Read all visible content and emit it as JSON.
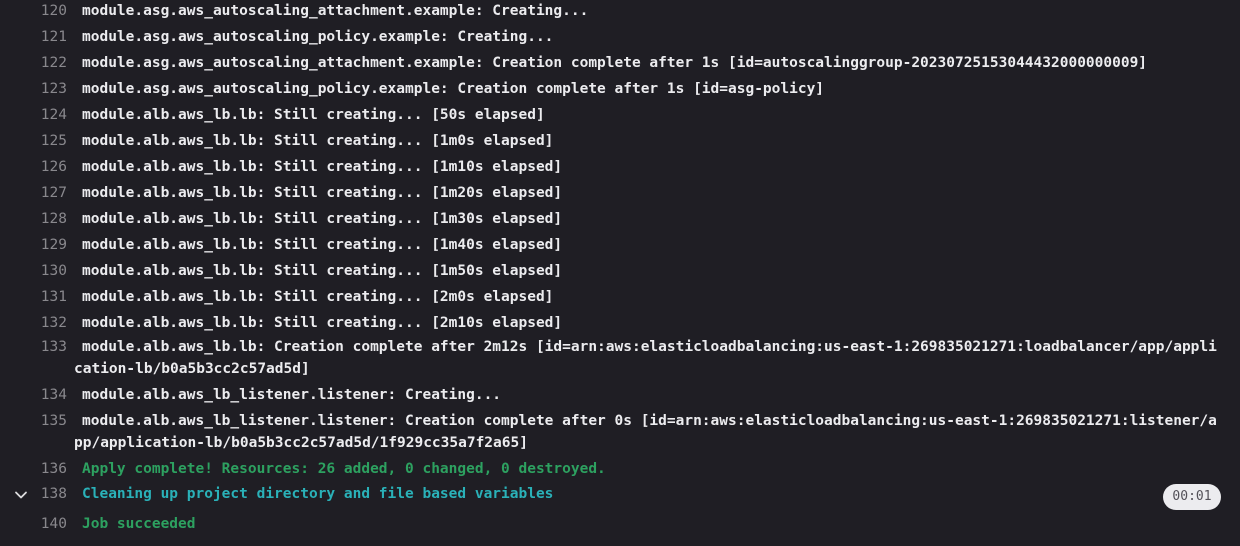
{
  "log": {
    "lines": [
      {
        "num": "120",
        "text": "module.asg.aws_autoscaling_attachment.example: Creating..."
      },
      {
        "num": "121",
        "text": "module.asg.aws_autoscaling_policy.example: Creating..."
      },
      {
        "num": "122",
        "text": "module.asg.aws_autoscaling_attachment.example: Creation complete after 1s [id=autoscalinggroup-20230725153044432000000009]"
      },
      {
        "num": "123",
        "text": "module.asg.aws_autoscaling_policy.example: Creation complete after 1s [id=asg-policy]"
      },
      {
        "num": "124",
        "text": "module.alb.aws_lb.lb: Still creating... [50s elapsed]"
      },
      {
        "num": "125",
        "text": "module.alb.aws_lb.lb: Still creating... [1m0s elapsed]"
      },
      {
        "num": "126",
        "text": "module.alb.aws_lb.lb: Still creating... [1m10s elapsed]"
      },
      {
        "num": "127",
        "text": "module.alb.aws_lb.lb: Still creating... [1m20s elapsed]"
      },
      {
        "num": "128",
        "text": "module.alb.aws_lb.lb: Still creating... [1m30s elapsed]"
      },
      {
        "num": "129",
        "text": "module.alb.aws_lb.lb: Still creating... [1m40s elapsed]"
      },
      {
        "num": "130",
        "text": "module.alb.aws_lb.lb: Still creating... [1m50s elapsed]"
      },
      {
        "num": "131",
        "text": "module.alb.aws_lb.lb: Still creating... [2m0s elapsed]"
      },
      {
        "num": "132",
        "text": "module.alb.aws_lb.lb: Still creating... [2m10s elapsed]"
      },
      {
        "num": "133",
        "text": "module.alb.aws_lb.lb: Creation complete after 2m12s [id=arn:aws:elasticloadbalancing:us-east-1:269835021271:loadbalancer/app/application-lb/b0a5b3cc2c57ad5d]"
      },
      {
        "num": "134",
        "text": "module.alb.aws_lb_listener.listener: Creating..."
      },
      {
        "num": "135",
        "text": "module.alb.aws_lb_listener.listener: Creation complete after 0s [id=arn:aws:elasticloadbalancing:us-east-1:269835021271:listener/app/application-lb/b0a5b3cc2c57ad5d/1f929cc35a7f2a65]"
      },
      {
        "num": "136",
        "text": "Apply complete! Resources: 26 added, 0 changed, 0 destroyed."
      },
      {
        "num": "138",
        "text": "Cleaning up project directory and file based variables"
      },
      {
        "num": "140",
        "text": "Job succeeded"
      }
    ],
    "section_duration": "00:01"
  },
  "icons": {
    "section_toggle": "chevron-down-icon"
  },
  "colors": {
    "background": "#1f1e24",
    "text": "#ececef",
    "line_number": "#89888d",
    "success_green": "#2da160",
    "section_teal": "#2ab1b8"
  }
}
